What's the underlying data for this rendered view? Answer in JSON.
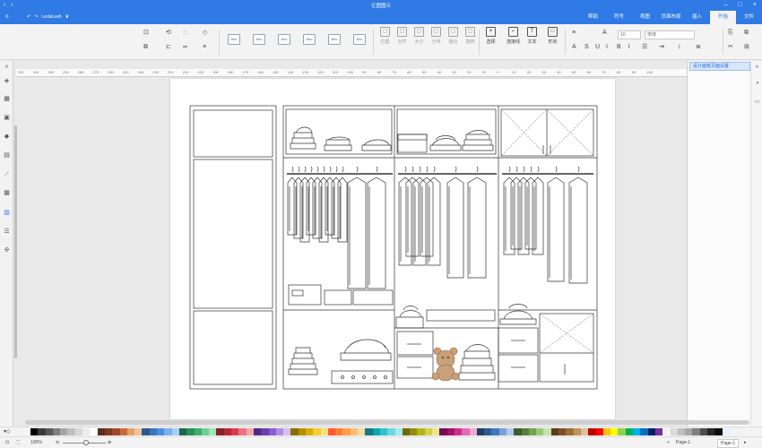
{
  "title": "亿图图示",
  "titlebar": {
    "left_icons": [
      "back-icon",
      "forward-icon"
    ],
    "window_buttons": [
      "minimize",
      "maximize",
      "close"
    ]
  },
  "menubar": {
    "left": {
      "icons": [
        "menu-icon",
        "undo-icon",
        "redo-icon"
      ],
      "user": "LedaLeeb",
      "extra": "⟲"
    },
    "tabs": [
      "文件",
      "开始",
      "插入",
      "页面布局",
      "视图",
      "符号",
      "帮助"
    ],
    "active_tab": "开始"
  },
  "toolbar": {
    "groups": [
      {
        "icon": "⌖",
        "label": "选择"
      },
      {
        "icon": "⌐",
        "label": "连接线"
      },
      {
        "icon": "T",
        "label": "文本"
      },
      {
        "icon": "□",
        "label": "形状"
      }
    ],
    "font_name": "宋体",
    "font_size": "10",
    "style_label": "Abc",
    "bold": "B",
    "italic": "I",
    "underline": "U",
    "strike": "S",
    "aa_up": "A",
    "aa_down": "A",
    "dimmed_tools": [
      "位置",
      "对齐",
      "大小",
      "分布",
      "组合",
      "旋转"
    ]
  },
  "right_panel": {
    "tab_label": "设计面板页面设置",
    "close": "×"
  },
  "ruler": {
    "ticks": [
      "320",
      "310",
      "300",
      "290",
      "280",
      "270",
      "260",
      "250",
      "240",
      "230",
      "220",
      "210",
      "200",
      "190",
      "180",
      "170",
      "160",
      "150",
      "140",
      "130",
      "120",
      "110",
      "100",
      "90",
      "80",
      "70",
      "60",
      "50",
      "40",
      "30",
      "20",
      "10",
      "0",
      "10",
      "20",
      "30",
      "40",
      "50",
      "60",
      "70",
      "80",
      "90",
      "100"
    ]
  },
  "status": {
    "page_name": "Page-1",
    "page_tab": "Page-1",
    "zoom": "100%",
    "add_page": "+"
  },
  "palette": {
    "colors": [
      "#000000",
      "#3a3a3a",
      "#595959",
      "#7f7f7f",
      "#a5a5a5",
      "#bfbfbf",
      "#d8d8d8",
      "#ececec",
      "#ffffff",
      "#5b2c1d",
      "#7e3b20",
      "#a04a27",
      "#c96a36",
      "#e3a16a",
      "#f1c59b",
      "#2e5a8a",
      "#3575c2",
      "#4a8fe0",
      "#7ab0ef",
      "#a9cdf5",
      "#1d6b4a",
      "#2a8e5d",
      "#3cb074",
      "#6ccf96",
      "#9fe3b9",
      "#8a1f2a",
      "#b3283a",
      "#d83d4f",
      "#ea7280",
      "#f4a7b0",
      "#4b2d7f",
      "#6a40ae",
      "#8b5fd4",
      "#b08ee6",
      "#d3bff3",
      "#8a6d00",
      "#b38f00",
      "#d9b000",
      "#f0cd33",
      "#f7e27f",
      "#ff5a36",
      "#ff7b3a",
      "#ff9d4d",
      "#ffbd73",
      "#ffd9a8",
      "#0e7c86",
      "#13a3ad",
      "#2fc3cc",
      "#6ad8de",
      "#a6e9ec",
      "#6b6b00",
      "#8f8f0a",
      "#b3b31a",
      "#d1d14a",
      "#e8e88a",
      "#7a0a4f",
      "#a4146b",
      "#cc2f8c",
      "#e26cb0",
      "#f1a9d1",
      "#1e3f66",
      "#2c5a93",
      "#3f78c0",
      "#79a2d6",
      "#b0c9ea",
      "#3f5e2c",
      "#577f3b",
      "#74a34f",
      "#9cc57a",
      "#c6e1ab",
      "#5c3b1e",
      "#7d5229",
      "#a06c38",
      "#c2935f",
      "#dfbf98",
      "#c00000",
      "#ff0000",
      "#ffc000",
      "#ffff00",
      "#92d050",
      "#00b050",
      "#00b0f0",
      "#0070c0",
      "#002060",
      "#7030a0",
      "#f2f2f2",
      "#d9d9d9",
      "#bfbfbf",
      "#a6a6a6",
      "#808080",
      "#4d4d4d",
      "#262626",
      "#0d0d0d",
      "#e6f2ff"
    ]
  }
}
